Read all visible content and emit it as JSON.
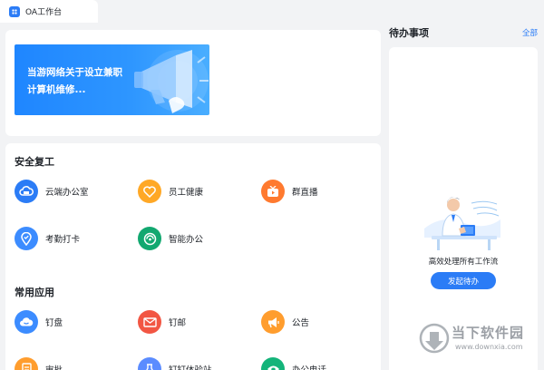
{
  "tab": {
    "label": "OA工作台",
    "icon": "grid-icon"
  },
  "banner": {
    "text": "当游网络关于设立兼职计算机维修...",
    "icon": "megaphone-icon"
  },
  "sections": {
    "safety": {
      "title": "安全复工",
      "apps": [
        {
          "label": "云端办公室",
          "color": "#2b7cf6",
          "icon": "cloud-office-icon"
        },
        {
          "label": "员工健康",
          "color": "#ffa826",
          "icon": "heart-icon"
        },
        {
          "label": "群直播",
          "color": "#ff7a2f",
          "icon": "live-tv-icon"
        },
        {
          "label": "考勤打卡",
          "color": "#3c8cff",
          "icon": "location-pin-icon"
        },
        {
          "label": "智能办公",
          "color": "#12a870",
          "icon": "smart-office-icon"
        }
      ]
    },
    "common": {
      "title": "常用应用",
      "apps": [
        {
          "label": "钉盘",
          "color": "#3c8cff",
          "icon": "cloud-disk-icon"
        },
        {
          "label": "钉邮",
          "color": "#f25643",
          "icon": "mail-icon"
        },
        {
          "label": "公告",
          "color": "#ff9d2e",
          "icon": "announcement-icon"
        },
        {
          "label": "审批",
          "color": "#ff9d2e",
          "icon": "approval-icon"
        },
        {
          "label": "钉钉体验站",
          "color": "#5b8cff",
          "icon": "experience-icon"
        },
        {
          "label": "办公电话",
          "color": "#14b47a",
          "icon": "phone-icon"
        }
      ]
    }
  },
  "todo": {
    "title": "待办事项",
    "all_link": "全部",
    "description": "高效处理所有工作流",
    "button": "发起待办"
  },
  "watermark": {
    "text": "当下软件园",
    "url": "www.downxia.com"
  }
}
